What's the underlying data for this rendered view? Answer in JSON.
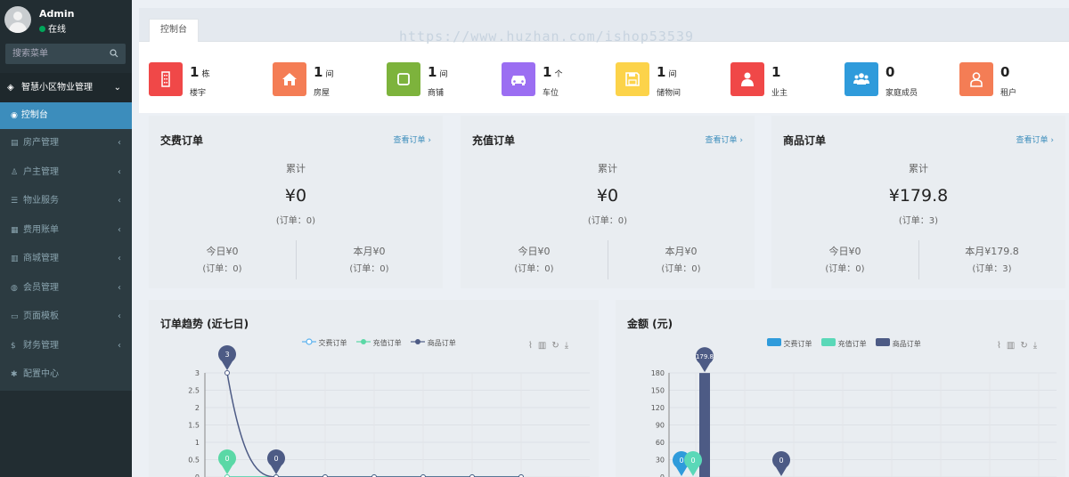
{
  "sidebar": {
    "user_name": "Admin",
    "user_status": "在线",
    "search_placeholder": "搜索菜单",
    "group_label": "智慧小区物业管理",
    "active_item": "控制台",
    "items": [
      {
        "label": "房产管理",
        "icon": "building-icon"
      },
      {
        "label": "户主管理",
        "icon": "user-icon"
      },
      {
        "label": "物业服务",
        "icon": "list-icon"
      },
      {
        "label": "费用账单",
        "icon": "bill-icon"
      },
      {
        "label": "商城管理",
        "icon": "shop-icon"
      },
      {
        "label": "会员管理",
        "icon": "member-icon"
      },
      {
        "label": "页面模板",
        "icon": "template-icon"
      },
      {
        "label": "财务管理",
        "icon": "dollar-icon"
      },
      {
        "label": "配置中心",
        "icon": "gear-icon"
      }
    ]
  },
  "tab": {
    "label": "控制台"
  },
  "watermark": "https://www.huzhan.com/ishop53539",
  "stats": [
    {
      "value": "1",
      "unit": "栋",
      "label": "楼宇",
      "color": "#f04848",
      "icon": "building-icon"
    },
    {
      "value": "1",
      "unit": "间",
      "label": "房屋",
      "color": "#f47d55",
      "icon": "home-icon"
    },
    {
      "value": "1",
      "unit": "间",
      "label": "商铺",
      "color": "#7db33c",
      "icon": "square-icon"
    },
    {
      "value": "1",
      "unit": "个",
      "label": "车位",
      "color": "#9b6ef2",
      "icon": "car-icon"
    },
    {
      "value": "1",
      "unit": "间",
      "label": "储物间",
      "color": "#fcd34a",
      "icon": "save-icon"
    },
    {
      "value": "1",
      "unit": "",
      "label": "业主",
      "color": "#f04848",
      "icon": "person-icon"
    },
    {
      "value": "0",
      "unit": "",
      "label": "家庭成员",
      "color": "#2f9bdb",
      "icon": "users-icon"
    },
    {
      "value": "0",
      "unit": "",
      "label": "租户",
      "color": "#f47d55",
      "icon": "tenant-icon"
    }
  ],
  "orders": [
    {
      "title": "交费订单",
      "link": "查看订单 ›",
      "cum_label": "累计",
      "total": "¥0",
      "count": "(订单：0)",
      "today_label": "今日",
      "today": "¥0",
      "today_count": "(订单：0)",
      "month_label": "本月",
      "month": "¥0",
      "month_count": "(订单：0)"
    },
    {
      "title": "充值订单",
      "link": "查看订单 ›",
      "cum_label": "累计",
      "total": "¥0",
      "count": "(订单：0)",
      "today_label": "今日",
      "today": "¥0",
      "today_count": "(订单：0)",
      "month_label": "本月",
      "month": "¥0",
      "month_count": "(订单：0)"
    },
    {
      "title": "商品订单",
      "link": "查看订单 ›",
      "cum_label": "累计",
      "total": "¥179.8",
      "count": "(订单：3)",
      "today_label": "今日",
      "today": "¥0",
      "today_count": "(订单：0)",
      "month_label": "本月",
      "month": "¥179.8",
      "month_count": "(订单：3)"
    }
  ],
  "chart_data": [
    {
      "type": "line",
      "title": "订单趋势 (近七日)",
      "legend": [
        "交费订单",
        "充值订单",
        "商品订单"
      ],
      "colors": [
        "#5ab1ef",
        "#5ad8a6",
        "#4d5b85"
      ],
      "ylim": [
        0,
        3
      ],
      "yticks": [
        "0",
        "0.5",
        "1",
        "1.5",
        "2",
        "2.5",
        "3"
      ],
      "series": [
        {
          "name": "交费订单",
          "values": [
            0,
            0,
            0,
            0,
            0,
            0,
            0
          ]
        },
        {
          "name": "充值订单",
          "values": [
            0,
            0,
            0,
            0,
            0,
            0,
            0
          ]
        },
        {
          "name": "商品订单",
          "values": [
            3,
            0,
            0,
            0,
            0,
            0,
            0
          ]
        }
      ],
      "markers": [
        {
          "series": "商品订单",
          "index": 0,
          "label": "3"
        },
        {
          "series": "充值订单",
          "index": 0,
          "label": "0"
        },
        {
          "series": "商品订单",
          "index": 1,
          "label": "0"
        }
      ]
    },
    {
      "type": "bar",
      "title": "金额 (元)",
      "legend": [
        "交费订单",
        "充值订单",
        "商品订单"
      ],
      "colors": [
        "#2f9bdb",
        "#5ad8b8",
        "#4d5b85"
      ],
      "ylim": [
        0,
        180
      ],
      "yticks": [
        "0",
        "30",
        "60",
        "90",
        "120",
        "150",
        "180"
      ],
      "series": [
        {
          "name": "交费订单",
          "values": [
            0,
            0
          ]
        },
        {
          "name": "充值订单",
          "values": [
            0,
            0
          ]
        },
        {
          "name": "商品订单",
          "values": [
            179.8,
            0
          ]
        }
      ],
      "markers": [
        {
          "series": "交费订单",
          "index": 0,
          "label": "0"
        },
        {
          "series": "充值订单",
          "index": 0,
          "label": "0"
        },
        {
          "series": "商品订单",
          "index": 0,
          "label": "179.8"
        },
        {
          "series": "商品订单",
          "index": 1,
          "label": "0"
        }
      ]
    }
  ]
}
